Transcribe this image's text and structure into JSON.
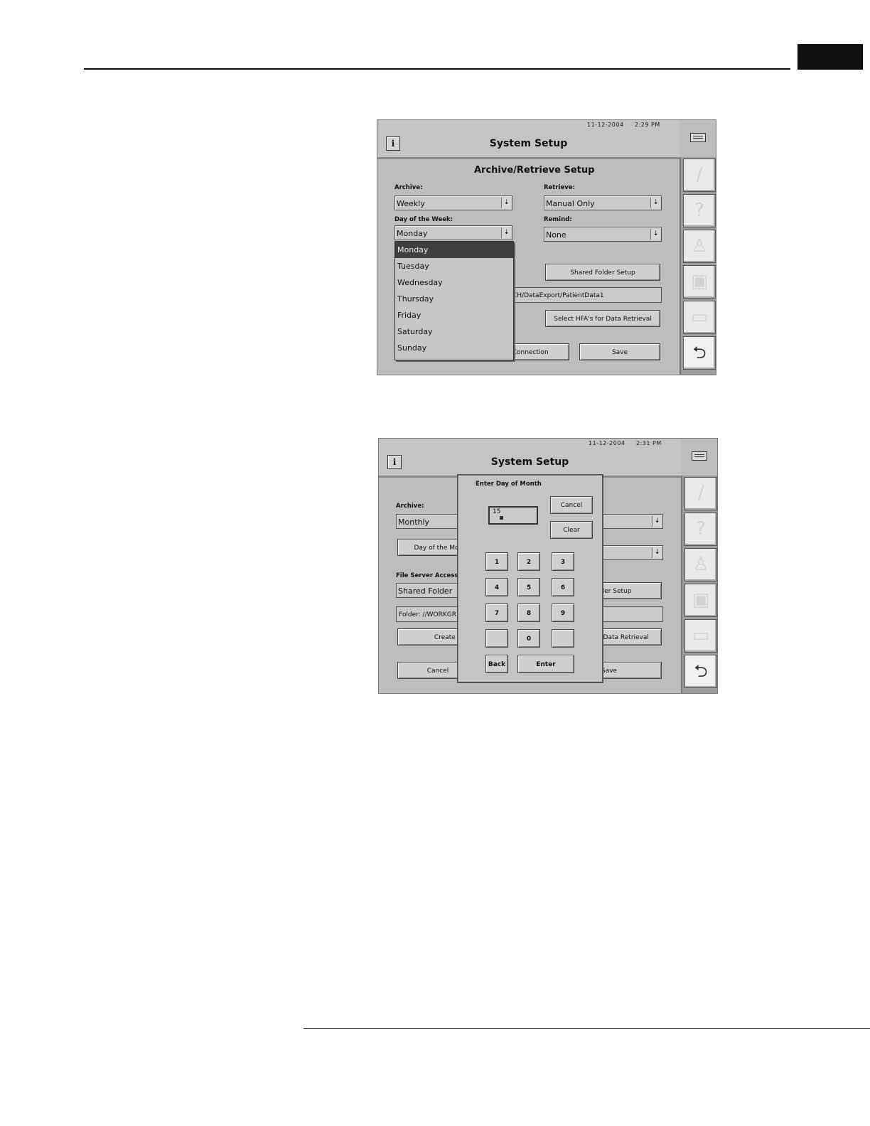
{
  "screen1": {
    "date": "11-12-2004",
    "time": "2:29 PM",
    "title": "System Setup",
    "section_title": "Archive/Retrieve Setup",
    "archive_label": "Archive:",
    "archive_value": "Weekly",
    "retrieve_label": "Retrieve:",
    "retrieve_value": "Manual Only",
    "day_of_week_label": "Day of the Week:",
    "day_of_week_value": "Monday",
    "remind_label": "Remind:",
    "remind_value": "None",
    "shared_folder_setup": "Shared Folder Setup",
    "folder_path": "CH/DataExport/PatientData1",
    "select_hfas": "Select HFA's for Data Retrieval",
    "test_connection": "t Connection",
    "save": "Save",
    "dropdown_options": [
      "Monday",
      "Tuesday",
      "Wednesday",
      "Thursday",
      "Friday",
      "Saturday",
      "Sunday"
    ],
    "selected_option": "Monday"
  },
  "screen2": {
    "date": "11-12-2004",
    "time": "2:31 PM",
    "title": "System Setup",
    "archive_label": "Archive:",
    "archive_value": "Monthly",
    "day_of_month_button": "Day of the Mo",
    "file_server_label": "File Server Access",
    "file_server_value": "Shared Folder",
    "folder_value": "Folder: //WORKGR",
    "create_archive": "Create Arch",
    "folder_setup": "lder Setup",
    "data_retrieval": "r Data Retrieval",
    "cancel": "Cancel",
    "save": "Save",
    "dialog": {
      "title": "Enter Day of Month",
      "value": "15",
      "cancel": "Cancel",
      "clear": "Clear",
      "keys": [
        "1",
        "2",
        "3",
        "4",
        "5",
        "6",
        "7",
        "8",
        "9",
        "",
        "0",
        ""
      ],
      "back": "Back",
      "enter": "Enter"
    }
  },
  "sidebar_icons": [
    "pen-icon",
    "help-icon",
    "person-icon",
    "disk-icon",
    "printer-icon",
    "return-icon"
  ]
}
